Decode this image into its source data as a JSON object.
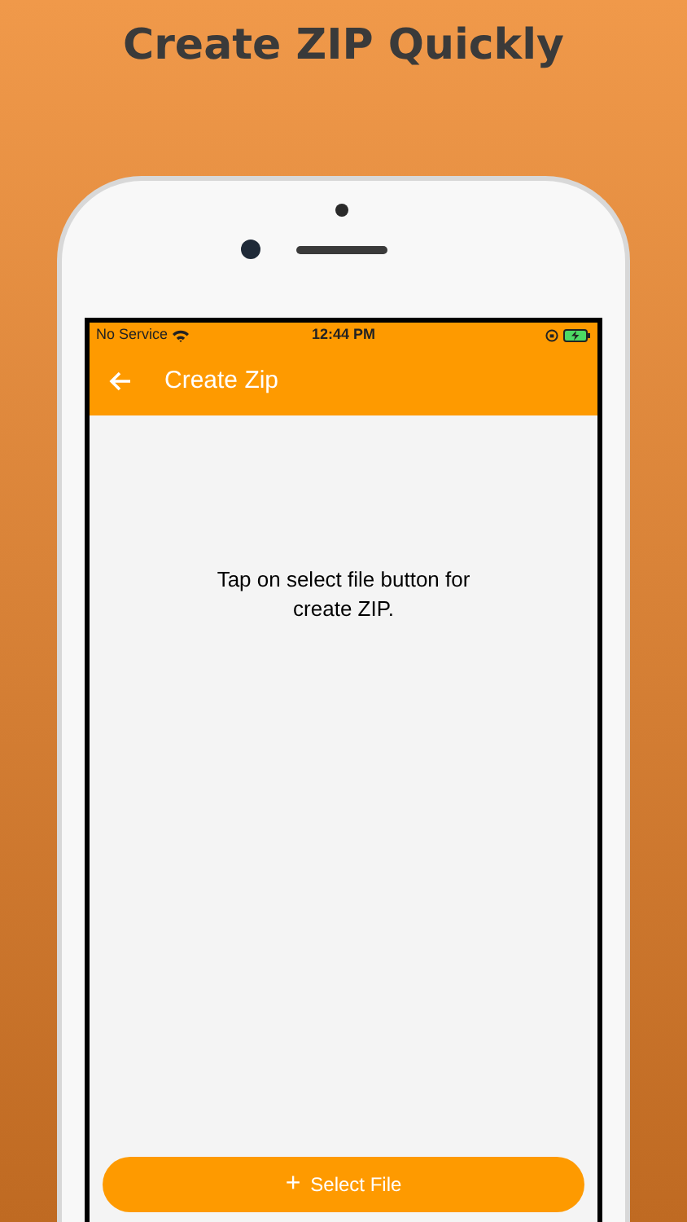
{
  "headline": "Create ZIP Quickly",
  "status_bar": {
    "carrier": "No Service",
    "time": "12:44 PM"
  },
  "app_bar": {
    "title": "Create Zip"
  },
  "message": "Tap on select file button for create ZIP.",
  "button": {
    "icon": "+",
    "label": "Select File"
  }
}
